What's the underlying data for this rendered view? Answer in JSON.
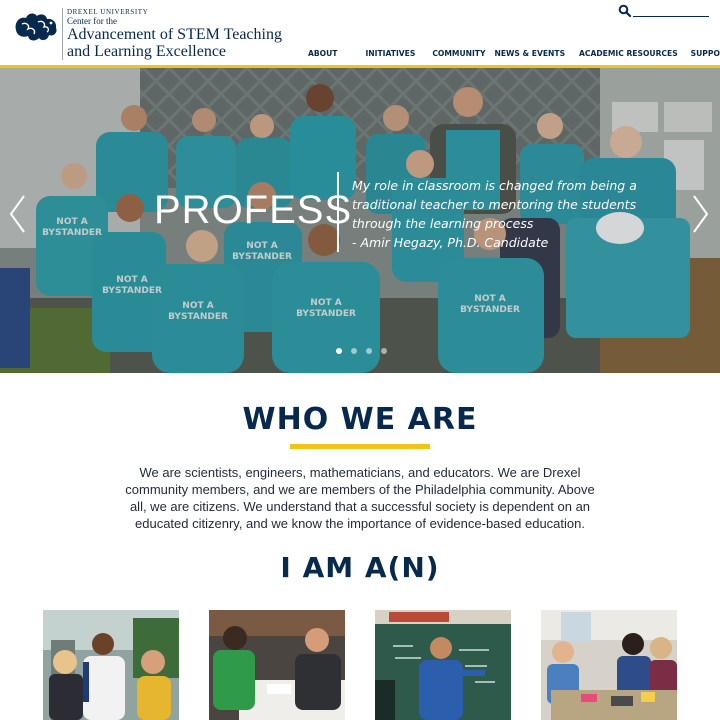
{
  "brand": {
    "university": "DREXEL UNIVERSITY",
    "center_line": "Center for the",
    "name_line1": "Advancement of STEM Teaching",
    "name_line2": "and Learning Excellence",
    "navy": "#07294d",
    "gold": "#f2c318"
  },
  "search": {
    "icon": "search-icon",
    "value": ""
  },
  "nav": {
    "items": [
      {
        "label": "ABOUT"
      },
      {
        "label": "INITIATIVES"
      },
      {
        "label": "COMMUNITY"
      },
      {
        "label": "NEWS & EVENTS"
      },
      {
        "label": "ACADEMIC RESOURCES"
      },
      {
        "label": "SUPPORT US"
      }
    ]
  },
  "hero": {
    "title": "PROFESS",
    "quote": "My role in classroom is changed from being a traditional teacher to mentoring the students through the learning process",
    "attribution": "- Amir Hegazy, Ph.D. Candidate",
    "prev_icon": "chevron-left-icon",
    "next_icon": "chevron-right-icon",
    "slides": 4,
    "active_slide": 1,
    "shirt_text_line1": "NOT A",
    "shirt_text_line2": "BYSTANDER"
  },
  "who": {
    "heading": "WHO WE ARE",
    "text": "We are scientists, engineers, mathematicians, and educators. We are Drexel community members, and we are members of the Philadelphia community. Above all, we are citizens. We understand that a successful society is dependent on an educated citizenry, and we know the importance of evidence-based education."
  },
  "iam": {
    "heading": "I AM A(N)"
  }
}
